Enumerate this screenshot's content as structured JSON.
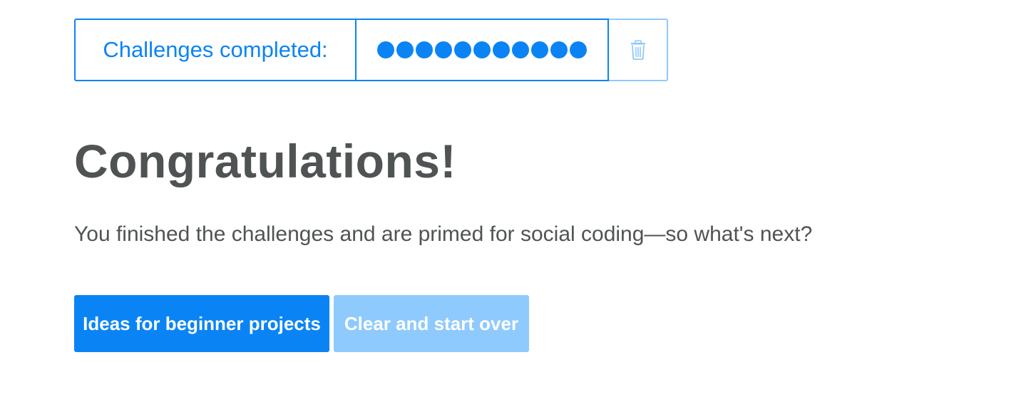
{
  "progress": {
    "label": "Challenges completed:",
    "completed_count": 11,
    "total_count": 11,
    "reset_icon": "trash-icon",
    "accent_color": "#0a84f5",
    "muted_color": "#8fc9fb"
  },
  "main": {
    "title": "Congratulations!",
    "lead": "You finished the challenges and are primed for social coding—so what's next?"
  },
  "actions": {
    "primary_label": "Ideas for beginner projects",
    "secondary_label": "Clear and start over",
    "primary_color": "#0a84f5",
    "secondary_color": "#8ecafd"
  }
}
